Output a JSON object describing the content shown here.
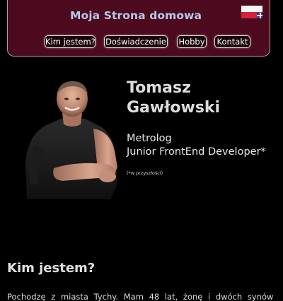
{
  "header": {
    "title": "Moja Strona domowa",
    "nav": [
      {
        "label": "Kim jestem?"
      },
      {
        "label": "Doświadczenie"
      },
      {
        "label": "Hobby"
      },
      {
        "label": "Kontakt"
      }
    ],
    "language_flags": [
      "flag-pl-icon",
      "flag-uk-icon"
    ]
  },
  "hero": {
    "first_name": "Tomasz",
    "last_name": "Gawłowski",
    "role_1": "Metrolog",
    "role_2": "Junior FrontEnd Developer*",
    "footnote": "(*w przyszłości)"
  },
  "about": {
    "heading": "Kim jestem?",
    "text": "Pochodzę z miasta Tychy. Mam 48 lat, żonę i dwóch synów"
  },
  "colors": {
    "background": "#000000",
    "header_bg": "#4d0a1e",
    "title_color": "#b7c9e6"
  }
}
